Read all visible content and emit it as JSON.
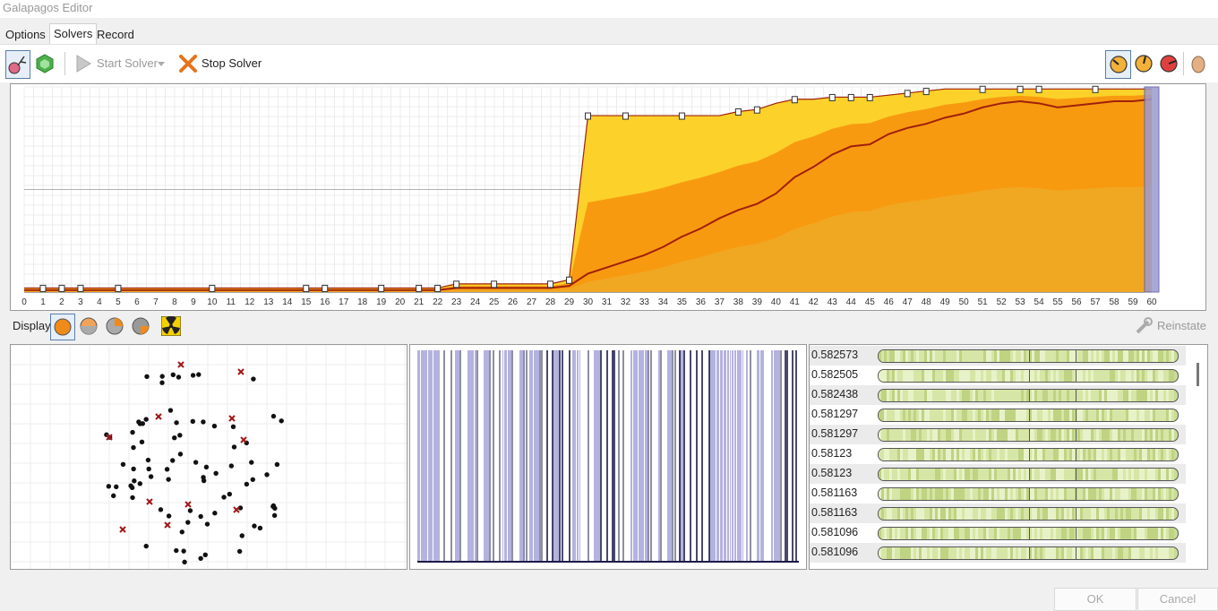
{
  "window": {
    "title": "Galapagos Editor"
  },
  "tabs": [
    {
      "label": "Options"
    },
    {
      "label": "Solvers"
    },
    {
      "label": "Record"
    }
  ],
  "toolbar": {
    "start_label": "Start Solver",
    "stop_label": "Stop Solver"
  },
  "chart_data": {
    "type": "area",
    "x_ticks": [
      "0",
      "1",
      "2",
      "3",
      "4",
      "5",
      "6",
      "7",
      "8",
      "9",
      "10",
      "11",
      "12",
      "13",
      "14",
      "15",
      "16",
      "17",
      "18",
      "19",
      "20",
      "21",
      "22",
      "23",
      "24",
      "25",
      "26",
      "27",
      "28",
      "29",
      "30",
      "31",
      "32",
      "33",
      "34",
      "35",
      "36",
      "37",
      "38",
      "39",
      "40",
      "41",
      "42",
      "43",
      "44",
      "45",
      "46",
      "47",
      "48",
      "49",
      "50",
      "51",
      "52",
      "53",
      "54",
      "55",
      "56",
      "57",
      "58",
      "59",
      "60"
    ],
    "ylim": [
      0,
      1
    ],
    "grid": true,
    "series": [
      {
        "values": [
          0.02,
          0.02,
          0.02,
          0.02,
          0.02,
          0.02,
          0.02,
          0.02,
          0.02,
          0.02,
          0.02,
          0.02,
          0.02,
          0.02,
          0.02,
          0.02,
          0.02,
          0.02,
          0.02,
          0.02,
          0.02,
          0.02,
          0.02,
          0.04,
          0.04,
          0.04,
          0.04,
          0.04,
          0.04,
          0.06,
          0.86,
          0.86,
          0.86,
          0.86,
          0.86,
          0.86,
          0.86,
          0.86,
          0.88,
          0.89,
          0.92,
          0.94,
          0.94,
          0.95,
          0.95,
          0.95,
          0.96,
          0.97,
          0.98,
          0.99,
          0.99,
          0.99,
          0.99,
          0.99,
          0.99,
          0.99,
          0.99,
          0.99,
          0.99,
          0.99,
          0.99
        ]
      },
      {
        "values": [
          0.01,
          0.01,
          0.01,
          0.01,
          0.01,
          0.01,
          0.01,
          0.01,
          0.01,
          0.01,
          0.01,
          0.01,
          0.01,
          0.01,
          0.01,
          0.01,
          0.01,
          0.01,
          0.01,
          0.01,
          0.01,
          0.01,
          0.01,
          0.02,
          0.02,
          0.02,
          0.02,
          0.02,
          0.02,
          0.03,
          0.09,
          0.12,
          0.15,
          0.18,
          0.22,
          0.27,
          0.31,
          0.36,
          0.4,
          0.43,
          0.48,
          0.56,
          0.61,
          0.67,
          0.71,
          0.72,
          0.77,
          0.8,
          0.82,
          0.85,
          0.87,
          0.9,
          0.92,
          0.93,
          0.92,
          0.9,
          0.91,
          0.92,
          0.93,
          0.93,
          0.94
        ]
      }
    ]
  },
  "display": {
    "label": "Display",
    "reinstate_label": "Reinstate"
  },
  "genome_list": [
    {
      "value": "0.582573"
    },
    {
      "value": "0.582505"
    },
    {
      "value": "0.582438"
    },
    {
      "value": "0.581297"
    },
    {
      "value": "0.581297"
    },
    {
      "value": "0.58123"
    },
    {
      "value": "0.58123"
    },
    {
      "value": "0.581163"
    },
    {
      "value": "0.581163"
    },
    {
      "value": "0.581096"
    },
    {
      "value": "0.581096"
    }
  ],
  "footer": {
    "ok_label": "OK",
    "cancel_label": "Cancel"
  },
  "colors": {
    "yellow": "#fbd12a",
    "orange": "#f89a10",
    "dark_red": "#a0200c",
    "selection": "#9c9ad0"
  }
}
